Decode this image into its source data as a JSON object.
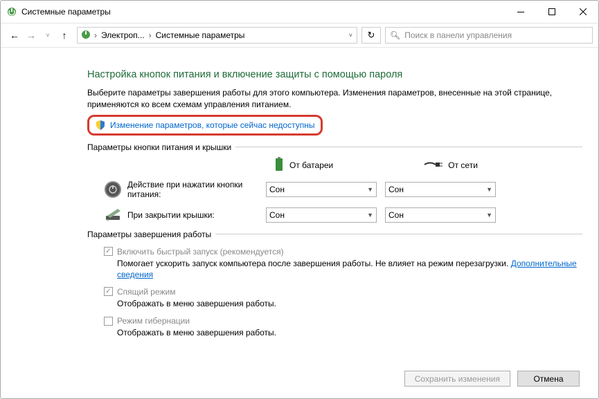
{
  "window": {
    "title": "Системные параметры"
  },
  "breadcrumb": {
    "seg1": "Электроп...",
    "seg2": "Системные параметры"
  },
  "search": {
    "placeholder": "Поиск в панели управления"
  },
  "heading": "Настройка кнопок питания и включение защиты с помощью пароля",
  "description": "Выберите параметры завершения работы для этого компьютера. Изменения параметров, внесенные на этой странице, применяются ко всем схемам управления питанием.",
  "link_change": "Изменение параметров, которые сейчас недоступны",
  "group1": {
    "label": "Параметры кнопки питания и крышки",
    "battery": "От батареи",
    "mains": "От сети",
    "power_btn_label": "Действие при нажатии кнопки питания:",
    "lid_label": "При закрытии крышки:",
    "combo_val": "Сон"
  },
  "group2": {
    "label": "Параметры завершения работы",
    "fast_start": "Включить быстрый запуск (рекомендуется)",
    "fast_sub": "Помогает ускорить запуск компьютера после завершения работы. Не влияет на режим перезагрузки. ",
    "fast_link": "Дополнительные сведения",
    "sleep": "Спящий режим",
    "sleep_sub": "Отображать в меню завершения работы.",
    "hibernate": "Режим гибернации",
    "hibernate_sub": "Отображать в меню завершения работы."
  },
  "footer": {
    "save": "Сохранить изменения",
    "cancel": "Отмена"
  }
}
